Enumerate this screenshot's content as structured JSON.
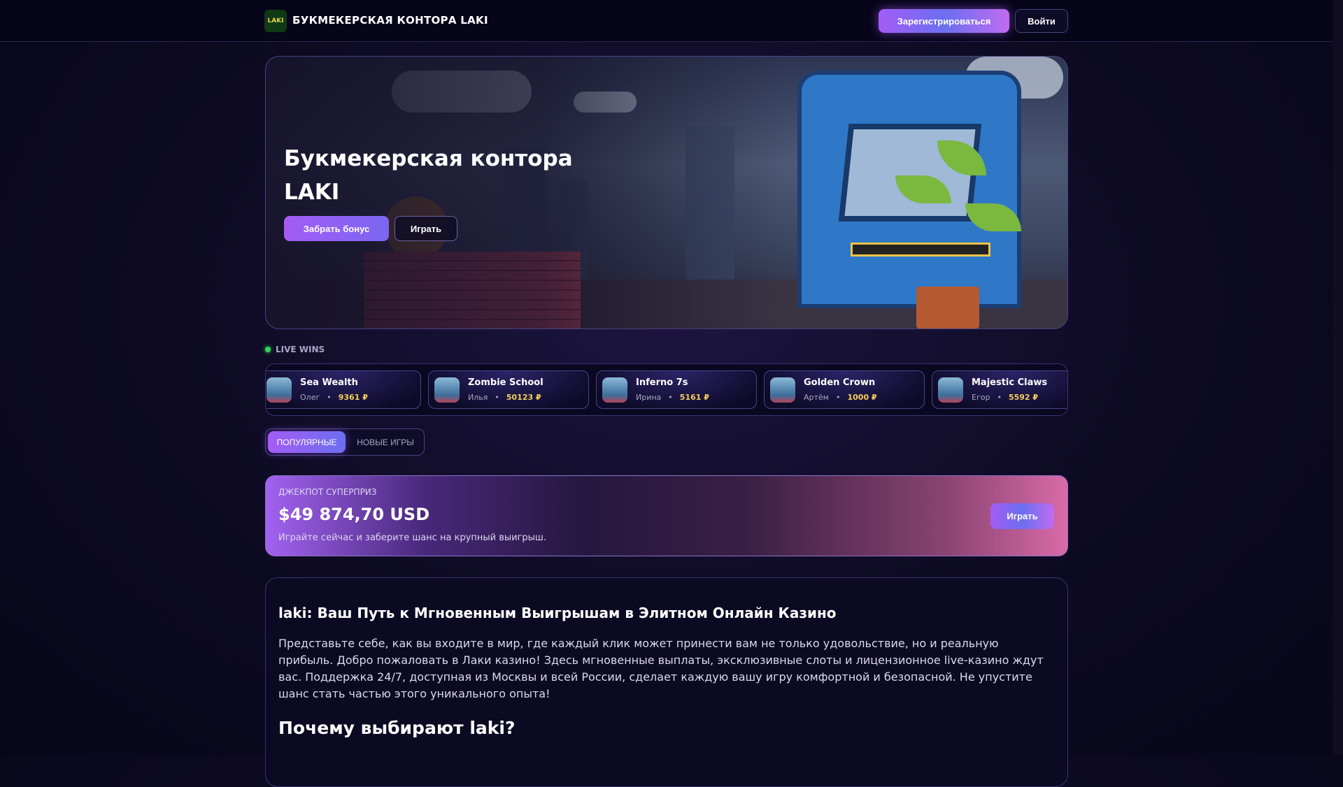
{
  "header": {
    "logo_text": "LAKI",
    "brand": "БУКМЕКЕРСКАЯ КОНТОРА LAKI",
    "register": "Зарегистрироваться",
    "login": "Войти"
  },
  "hero": {
    "title": "Букмекерская контора LAKI",
    "bonus_button": "Забрать бонус",
    "play_button": "Играть"
  },
  "live_wins": {
    "label": "LIVE WINS",
    "items": [
      {
        "game": "Sea Wealth",
        "player": "Олег",
        "amount": "9361 ₽"
      },
      {
        "game": "Zombie School",
        "player": "Илья",
        "amount": "50123 ₽"
      },
      {
        "game": "Inferno 7s",
        "player": "Ирина",
        "amount": "5161 ₽"
      },
      {
        "game": "Golden Crown",
        "player": "Артём",
        "amount": "1000 ₽"
      },
      {
        "game": "Majestic Claws",
        "player": "Егор",
        "amount": "5592 ₽"
      }
    ]
  },
  "tabs": {
    "popular": "ПОПУЛЯРНЫЕ",
    "new": "НОВЫЕ ИГРЫ"
  },
  "jackpot": {
    "label": "ДЖЕКПОТ СУПЕРПРИЗ",
    "amount": "$49 874,70 USD",
    "description": "Играйте сейчас и заберите шанс на крупный выигрыш.",
    "button": "Играть"
  },
  "article": {
    "heading": "laki: Ваш Путь к Мгновенным Выигрышам в Элитном Онлайн Казино",
    "paragraph": "Представьте себе, как вы входите в мир, где каждый клик может принести вам не только удовольствие, но и реальную прибыль. Добро пожаловать в Лаки казино! Здесь мгновенные выплаты, эксклюзивные слоты и лицензионное live-казино ждут вас. Поддержка 24/7, доступная из Москвы и всей России, сделает каждую вашу игру комфортной и безопасной. Не упустите шанс стать частью этого уникального опыта!",
    "subheading": "Почему выбирают laki?"
  }
}
